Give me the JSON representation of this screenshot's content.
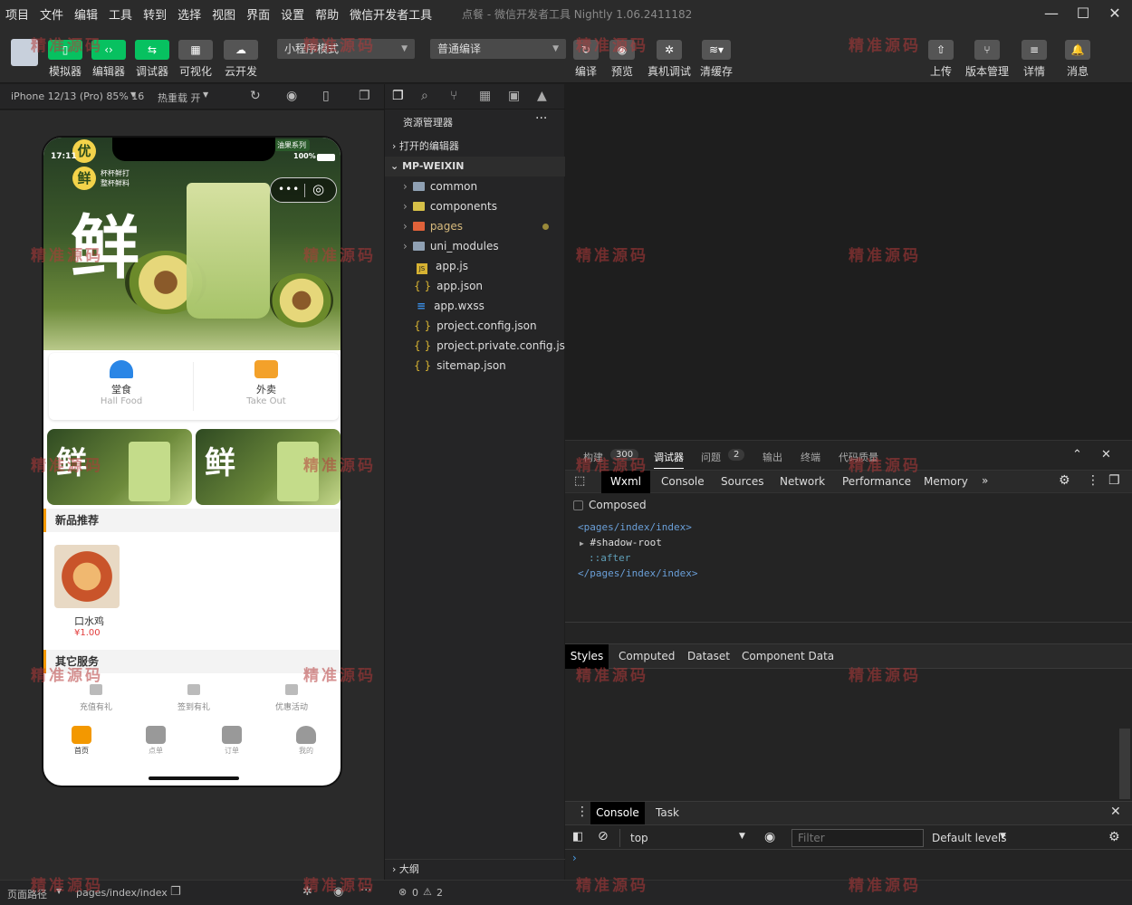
{
  "menu": [
    "项目",
    "文件",
    "编辑",
    "工具",
    "转到",
    "选择",
    "视图",
    "界面",
    "设置",
    "帮助",
    "微信开发者工具"
  ],
  "window_title": "点餐 - 微信开发者工具 Nightly 1.06.2411182",
  "toolbar": {
    "simulator": "模拟器",
    "editor": "编辑器",
    "debugger": "调试器",
    "visual": "可视化",
    "cloud": "云开发",
    "mode_select": "小程序模式",
    "compile_select": "普通编译",
    "compile": "编译",
    "preview": "预览",
    "real_debug": "真机调试",
    "clear_cache": "清缓存",
    "upload": "上传",
    "version": "版本管理",
    "details": "详情",
    "messages": "消息"
  },
  "simbar": {
    "device": "iPhone 12/13 (Pro) 85% 16",
    "hot_reload": "热重载 开"
  },
  "phone": {
    "time": "17:11",
    "battery": "100%",
    "hero_char": "鲜",
    "hero_badge": "优",
    "hero_sub_badge": "鲜",
    "hero_tagline1": "杯杯鲜打",
    "hero_tagline2": "整杯鲜料",
    "hero_series": "油果系列",
    "modes": [
      {
        "name": "堂食",
        "en": "Hall Food"
      },
      {
        "name": "外卖",
        "en": "Take Out"
      }
    ],
    "banner_char": "鲜",
    "section_new": "新品推荐",
    "product": {
      "name": "口水鸡",
      "price": "¥1.00"
    },
    "section_other": "其它服务",
    "services": [
      "充值有礼",
      "签到有礼",
      "优惠活动"
    ],
    "tabs": [
      "首页",
      "点单",
      "订单",
      "我的"
    ]
  },
  "explorer": {
    "title": "资源管理器",
    "open_editors": "打开的编辑器",
    "root": "MP-WEIXIN",
    "items": [
      {
        "name": "common",
        "type": "folder"
      },
      {
        "name": "components",
        "type": "folder"
      },
      {
        "name": "pages",
        "type": "folder"
      },
      {
        "name": "uni_modules",
        "type": "folder"
      },
      {
        "name": "app.js",
        "type": "js"
      },
      {
        "name": "app.json",
        "type": "json"
      },
      {
        "name": "app.wxss",
        "type": "wxss"
      },
      {
        "name": "project.config.json",
        "type": "json"
      },
      {
        "name": "project.private.config.js...",
        "type": "json"
      },
      {
        "name": "sitemap.json",
        "type": "json"
      }
    ],
    "outline": "大纲"
  },
  "devtools": {
    "top_tabs": {
      "build": "构建",
      "build_count": "300",
      "debugger": "调试器",
      "issues": "问题",
      "issues_count": "2",
      "output": "输出",
      "terminal": "终端",
      "code_quality": "代码质量"
    },
    "tabs": [
      "Wxml",
      "Console",
      "Sources",
      "Network",
      "Performance",
      "Memory"
    ],
    "composed": "Composed",
    "wxml": [
      "<pages/index/index>",
      "#shadow-root",
      "::after",
      "</pages/index/index>"
    ],
    "style_tabs": [
      "Styles",
      "Computed",
      "Dataset",
      "Component Data"
    ],
    "drawer_tabs": [
      "Console",
      "Task"
    ],
    "context": "top",
    "filter_placeholder": "Filter",
    "levels": "Default levels"
  },
  "statusbar": {
    "path_label": "页面路径",
    "path": "pages/index/index",
    "errors": "0",
    "warnings": "2"
  },
  "watermark": "精准源码",
  "colors": {
    "accent": "#07c160",
    "orange": "#f39800",
    "price": "#e23c3c"
  }
}
